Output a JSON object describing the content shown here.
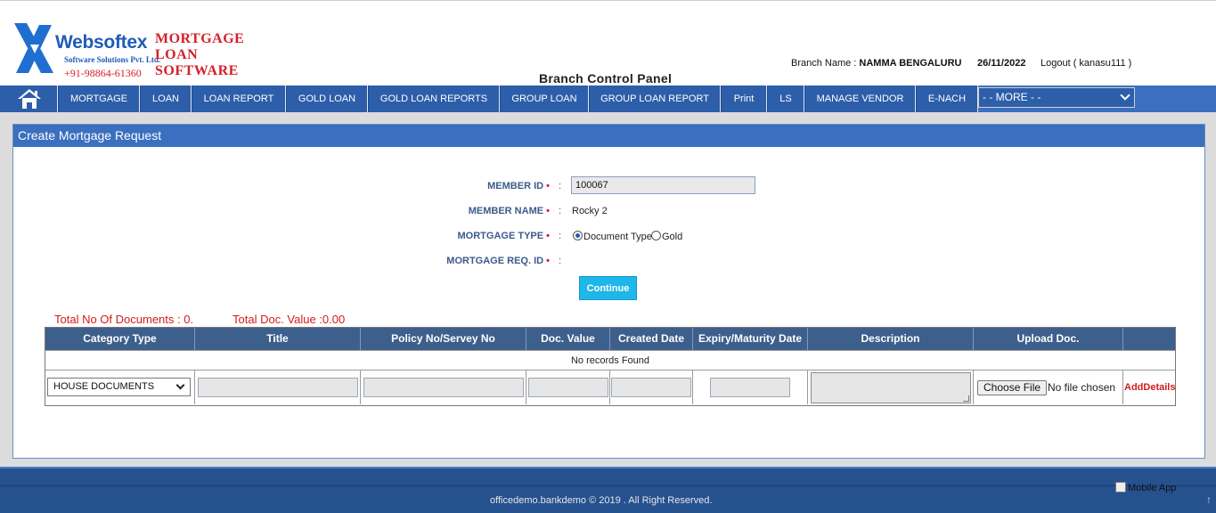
{
  "header": {
    "brand_name": "Websoftex",
    "brand_tagline": "Software Solutions Pvt. Ltd.",
    "brand_phone": "+91-98864-61360",
    "product_line1": "MORTGAGE",
    "product_line2": "LOAN",
    "product_line3": "SOFTWARE",
    "panel_title": "Branch Control Panel",
    "branch_label": "Branch Name : ",
    "branch_value": "NAMMA BENGALURU",
    "date": "26/11/2022",
    "logout": "Logout ( kanasu111 )"
  },
  "nav": {
    "items": [
      {
        "label": "MORTGAGE"
      },
      {
        "label": "LOAN"
      },
      {
        "label": "LOAN REPORT"
      },
      {
        "label": "GOLD LOAN"
      },
      {
        "label": "GOLD LOAN REPORTS"
      },
      {
        "label": "GROUP LOAN"
      },
      {
        "label": "GROUP LOAN REPORT"
      },
      {
        "label": "Print"
      },
      {
        "label": "LS"
      },
      {
        "label": "MANAGE VENDOR"
      },
      {
        "label": "E-NACH"
      }
    ],
    "more": "- - MORE - -"
  },
  "panel": {
    "title": "Create Mortgage Request",
    "member_id_label": "MEMBER ID",
    "member_id_value": "100067",
    "member_name_label": "MEMBER NAME",
    "member_name_value": "Rocky 2",
    "mortgage_type_label": "MORTGAGE TYPE",
    "mortgage_type_options": [
      "Document Type",
      "Gold"
    ],
    "mortgage_req_label": "MORTGAGE REQ. ID",
    "required_mark": "•",
    "colon": ":",
    "continue": "Continue",
    "total_docs": "Total No Of Documents : 0.",
    "total_value": "Total Doc. Value :0.00"
  },
  "table": {
    "headers": [
      "Category Type",
      "Title",
      "Policy No/Servey No",
      "Doc. Value",
      "Created Date",
      "Expiry/Maturity Date",
      "Description",
      "Upload Doc.",
      ""
    ],
    "no_records": "No records Found",
    "category_selected": "HOUSE DOCUMENTS",
    "choose_file": "Choose File",
    "no_file": "No file chosen",
    "add_details": "AddDetails"
  },
  "footer": {
    "copyright": "officedemo.bankdemo © 2019 . All Right Reserved.",
    "mobile_app": "Mobile App"
  },
  "colors": {
    "nav_blue": "#3b6fbf",
    "brand_blue": "#1f5cb8",
    "brand_red": "#d51f26",
    "button_cyan": "#1fb6e8"
  }
}
